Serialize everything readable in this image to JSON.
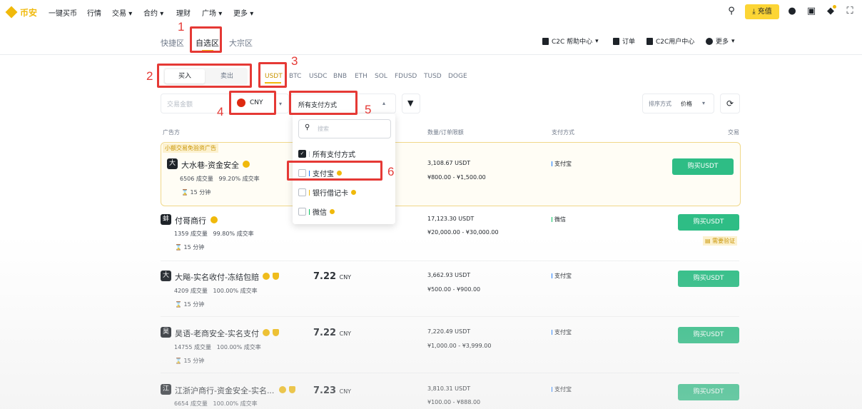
{
  "nav": {
    "logo": "币安",
    "items": [
      "一键买币",
      "行情",
      "交易",
      "合约",
      "理财",
      "广场",
      "更多"
    ],
    "deposit": "充值"
  },
  "tabs": [
    "快捷区",
    "自选区",
    "大宗区"
  ],
  "right_links": [
    "C2C 帮助中心",
    "订单",
    "C2C用户中心",
    "更多"
  ],
  "buysell": {
    "buy": "买入",
    "sell": "卖出"
  },
  "coins": [
    "USDT",
    "BTC",
    "USDC",
    "BNB",
    "ETH",
    "SOL",
    "FDUSD",
    "TUSD",
    "DOGE"
  ],
  "filters": {
    "amount_placeholder": "交易金额",
    "currency": "CNY",
    "payment": "所有支付方式",
    "sort_label": "排序方式",
    "sort_value": "价格"
  },
  "headers": [
    "广告方",
    "数量/订单限额",
    "支付方式",
    "交易"
  ],
  "dropdown": {
    "search_placeholder": "搜索",
    "items": [
      "所有支付方式",
      "支付宝",
      "银行借记卡",
      "微信"
    ]
  },
  "promo_tag": "小额交易免验资广告",
  "verify_tag": "需要验证",
  "rows": [
    {
      "avatar": "大",
      "name": "大水巷-资金安全",
      "orders": "6506 成交量",
      "rate": "99.20% 成交率",
      "time": "15 分钟",
      "price": "",
      "unit": "",
      "amount": "3,108.67 USDT",
      "limit": "¥800.00 - ¥1,500.00",
      "pay": "支付宝",
      "button": "购买USDT"
    },
    {
      "avatar": "蚌",
      "name": "付哥商行",
      "orders": "1359 成交量",
      "rate": "99.80% 成交率",
      "time": "15 分钟",
      "price": "",
      "unit": "",
      "amount": "17,123.30 USDT",
      "limit": "¥20,000.00 - ¥30,000.00",
      "pay": "微信",
      "button": "购买USDT"
    },
    {
      "avatar": "大",
      "name": "大飚-实名收付-冻结包赔",
      "orders": "4209 成交量",
      "rate": "100.00% 成交率",
      "time": "15 分钟",
      "price": "7.22",
      "unit": "CNY",
      "amount": "3,662.93 USDT",
      "limit": "¥500.00 - ¥900.00",
      "pay": "支付宝",
      "button": "购买USDT"
    },
    {
      "avatar": "昊",
      "name": "昊语-老商安全-实名支付",
      "orders": "14755 成交量",
      "rate": "100.00% 成交率",
      "time": "15 分钟",
      "price": "7.22",
      "unit": "CNY",
      "amount": "7,220.49 USDT",
      "limit": "¥1,000.00 - ¥3,999.00",
      "pay": "支付宝",
      "button": "购买USDT"
    },
    {
      "avatar": "江",
      "name": "江浙沪商行-资金安全-实名...",
      "orders": "6654 成交量",
      "rate": "100.00% 成交率",
      "time": "",
      "price": "7.23",
      "unit": "CNY",
      "amount": "3,810.31 USDT",
      "limit": "¥100.00 - ¥888.00",
      "pay": "支付宝",
      "button": "购买USDT"
    }
  ],
  "annotations": [
    "1",
    "2",
    "3",
    "4",
    "5",
    "6"
  ],
  "colors": {
    "brand": "#F0B90B",
    "buy": "#2ebd85",
    "annotation": "#e53935"
  }
}
